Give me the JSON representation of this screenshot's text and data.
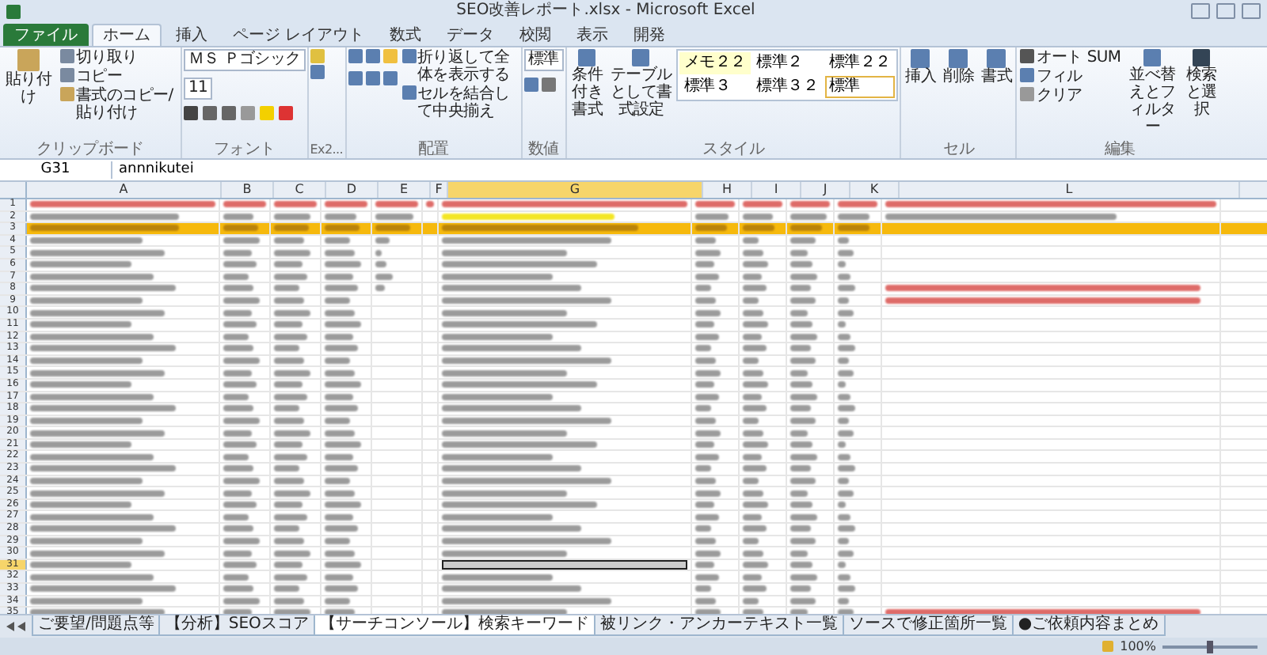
{
  "window": {
    "title": "SEO改善レポート.xlsx - Microsoft Excel"
  },
  "tabs": [
    {
      "label": "ファイル",
      "kind": "file",
      "selected": false
    },
    {
      "label": "ホーム",
      "kind": "tab",
      "selected": true
    },
    {
      "label": "挿入",
      "kind": "tab",
      "selected": false
    },
    {
      "label": "ページ レイアウト",
      "kind": "tab",
      "selected": false
    },
    {
      "label": "数式",
      "kind": "tab",
      "selected": false
    },
    {
      "label": "データ",
      "kind": "tab",
      "selected": false
    },
    {
      "label": "校閲",
      "kind": "tab",
      "selected": false
    },
    {
      "label": "表示",
      "kind": "tab",
      "selected": false
    },
    {
      "label": "開発",
      "kind": "tab",
      "selected": false
    }
  ],
  "ribbon": {
    "clipboard": {
      "label": "クリップボード",
      "paste": "貼り付け",
      "cut": "切り取り",
      "copy": "コピー",
      "format_painter": "書式のコピー/貼り付け"
    },
    "font": {
      "label": "フォント",
      "name": "ＭＳ Ｐゴシック",
      "size": "11"
    },
    "extra": {
      "label": "Ex2..."
    },
    "alignment": {
      "label": "配置",
      "wrap": "折り返して全体を表示する",
      "merge": "セルを結合して中央揃え"
    },
    "number": {
      "label": "数値",
      "format": "標準"
    },
    "styles": {
      "label": "スタイル",
      "conditional": "条件付き書式",
      "table": "テーブルとして書式設定",
      "presets": [
        {
          "label": "メモ２２",
          "kind": "note",
          "selected": false
        },
        {
          "label": "標準２",
          "kind": "plain",
          "selected": false
        },
        {
          "label": "標準２２",
          "kind": "plain",
          "selected": false
        },
        {
          "label": "標準３",
          "kind": "plain",
          "selected": false
        },
        {
          "label": "標準３２",
          "kind": "plain",
          "selected": false
        },
        {
          "label": "標準",
          "kind": "plain",
          "selected": true
        }
      ]
    },
    "cells": {
      "label": "セル",
      "buttons": [
        "挿入",
        "削除",
        "書式"
      ]
    },
    "editing": {
      "label": "編集",
      "autosum": "オート SUM",
      "fill": "フィル",
      "clear": "クリア",
      "sort": "並べ替えとフィルター",
      "find": "検索と選択"
    }
  },
  "formula_bar": {
    "name_box": "G31",
    "formula": "annnikutei"
  },
  "columns": [
    {
      "label": "A",
      "selected": false
    },
    {
      "label": "B",
      "selected": false
    },
    {
      "label": "C",
      "selected": false
    },
    {
      "label": "D",
      "selected": false
    },
    {
      "label": "E",
      "selected": false
    },
    {
      "label": "F",
      "selected": false
    },
    {
      "label": "G",
      "selected": true
    },
    {
      "label": "H",
      "selected": false
    },
    {
      "label": "I",
      "selected": false
    },
    {
      "label": "J",
      "selected": false
    },
    {
      "label": "K",
      "selected": false
    },
    {
      "label": "L",
      "selected": false
    }
  ],
  "rows": [
    {
      "number": "1",
      "kind": "note",
      "selected": false
    },
    {
      "number": "2",
      "kind": "header",
      "selected": false
    },
    {
      "number": "3",
      "kind": "band",
      "selected": false
    },
    {
      "number": "4",
      "kind": "data",
      "selected": false
    },
    {
      "number": "5",
      "kind": "data",
      "selected": false
    },
    {
      "number": "6",
      "kind": "data",
      "selected": false
    },
    {
      "number": "7",
      "kind": "data",
      "selected": false
    },
    {
      "number": "8",
      "kind": "data-note",
      "selected": false
    },
    {
      "number": "9",
      "kind": "data-note",
      "selected": false
    },
    {
      "number": "10",
      "kind": "data",
      "selected": false
    },
    {
      "number": "11",
      "kind": "data",
      "selected": false
    },
    {
      "number": "12",
      "kind": "data",
      "selected": false
    },
    {
      "number": "13",
      "kind": "data",
      "selected": false
    },
    {
      "number": "14",
      "kind": "data",
      "selected": false
    },
    {
      "number": "15",
      "kind": "data",
      "selected": false
    },
    {
      "number": "16",
      "kind": "data",
      "selected": false
    },
    {
      "number": "17",
      "kind": "data",
      "selected": false
    },
    {
      "number": "18",
      "kind": "data",
      "selected": false
    },
    {
      "number": "19",
      "kind": "data",
      "selected": false
    },
    {
      "number": "20",
      "kind": "data",
      "selected": false
    },
    {
      "number": "21",
      "kind": "data",
      "selected": false
    },
    {
      "number": "22",
      "kind": "data",
      "selected": false
    },
    {
      "number": "23",
      "kind": "data",
      "selected": false
    },
    {
      "number": "24",
      "kind": "data",
      "selected": false
    },
    {
      "number": "25",
      "kind": "data",
      "selected": false
    },
    {
      "number": "26",
      "kind": "data",
      "selected": false
    },
    {
      "number": "27",
      "kind": "data",
      "selected": false
    },
    {
      "number": "28",
      "kind": "data",
      "selected": false
    },
    {
      "number": "29",
      "kind": "data",
      "selected": false
    },
    {
      "number": "30",
      "kind": "data",
      "selected": false
    },
    {
      "number": "31",
      "kind": "data",
      "selected": true
    },
    {
      "number": "32",
      "kind": "data",
      "selected": false
    },
    {
      "number": "33",
      "kind": "data",
      "selected": false
    },
    {
      "number": "34",
      "kind": "data",
      "selected": false
    },
    {
      "number": "35",
      "kind": "data-note",
      "selected": false
    }
  ],
  "sheet_tabs": [
    {
      "label": "ご要望/問題点等",
      "selected": false
    },
    {
      "label": "【分析】SEOスコア",
      "selected": false
    },
    {
      "label": "【サーチコンソール】検索キーワード",
      "selected": true
    },
    {
      "label": "被リンク・アンカーテキスト一覧",
      "selected": false
    },
    {
      "label": "ソースで修正箇所一覧",
      "selected": false
    },
    {
      "label": "●ご依頼内容まとめ",
      "selected": false
    }
  ],
  "status_bar": {
    "zoom": "100%",
    "zoom_slider": {
      "level": 0.5
    }
  }
}
